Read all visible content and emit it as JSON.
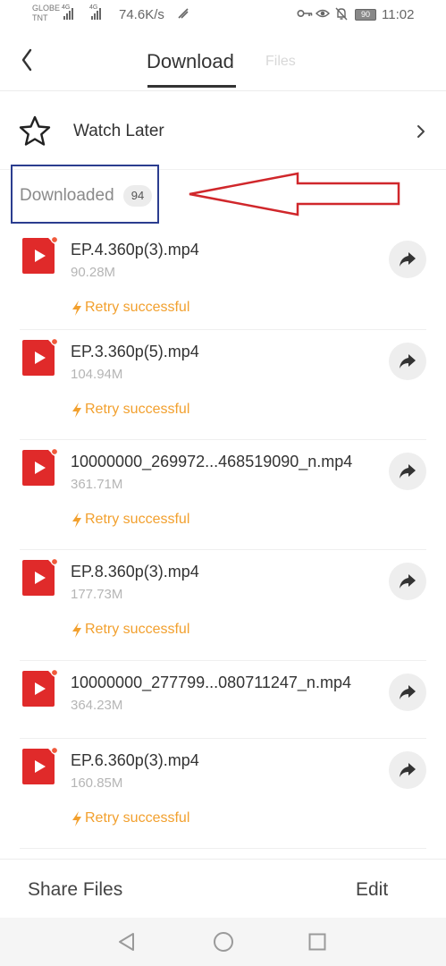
{
  "status_bar": {
    "carrier_1": "GLOBE",
    "carrier_2": "TNT",
    "network_1": "4G",
    "network_2": "4G",
    "speed": "74.6K/s",
    "battery": "90",
    "time": "11:02",
    "icons": [
      "nfc-icon",
      "key-icon",
      "eye-icon",
      "bell-off-icon",
      "battery-icon"
    ]
  },
  "header": {
    "active_tab": "Download",
    "inactive_tab": "Files"
  },
  "watch_later": {
    "label": "Watch Later"
  },
  "downloaded": {
    "label": "Downloaded",
    "count": "94"
  },
  "files": [
    {
      "name": "EP.4.360p(3).mp4",
      "size": "90.28M",
      "status": "Retry successful"
    },
    {
      "name": "EP.3.360p(5).mp4",
      "size": "104.94M",
      "status": "Retry successful"
    },
    {
      "name": "10000000_269972...468519090_n.mp4",
      "size": "361.71M",
      "status": "Retry successful"
    },
    {
      "name": "EP.8.360p(3).mp4",
      "size": "177.73M",
      "status": "Retry successful"
    },
    {
      "name": "10000000_277799...080711247_n.mp4",
      "size": "364.23M",
      "status": ""
    },
    {
      "name": "EP.6.360p(3).mp4",
      "size": "160.85M",
      "status": "Retry successful"
    }
  ],
  "bottom_bar": {
    "share_label": "Share Files",
    "edit_label": "Edit"
  },
  "colors": {
    "file_icon": "#e02a2a",
    "status_orange": "#f2a02e",
    "annotation_box": "#2b3d8f",
    "annotation_arrow": "#d0272b"
  }
}
